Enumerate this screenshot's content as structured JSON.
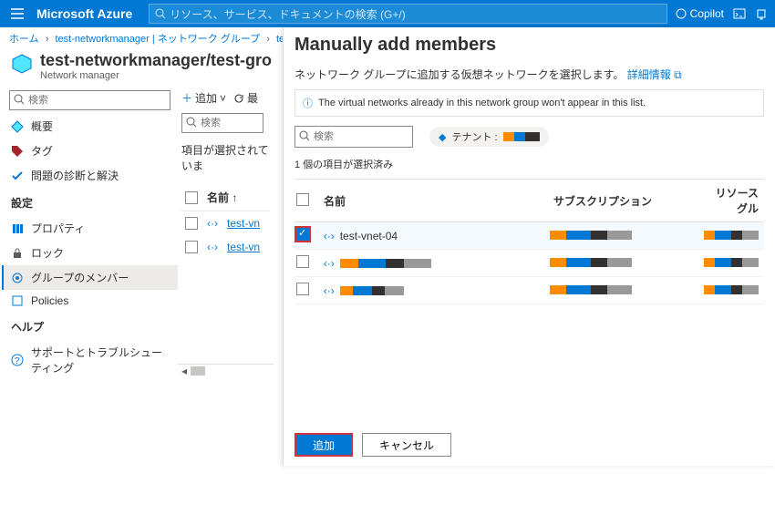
{
  "topbar": {
    "brand": "Microsoft Azure",
    "search_placeholder": "リソース、サービス、ドキュメントの検索 (G+/)",
    "copilot": "Copilot"
  },
  "breadcrumb": {
    "items": [
      "ホーム",
      "test-networkmanager | ネットワーク グループ",
      "test-n"
    ]
  },
  "page": {
    "title": "test-networkmanager/test-gro",
    "subtitle": "Network manager"
  },
  "side": {
    "search_placeholder": "検索",
    "items_top": [
      {
        "icon": "overview-icon",
        "label": "概要",
        "color": "#0078d4"
      },
      {
        "icon": "tag-icon",
        "label": "タグ",
        "color": "#a4262c"
      },
      {
        "icon": "diagnose-icon",
        "label": "問題の診断と解決",
        "color": "#0078d4"
      }
    ],
    "section1": "設定",
    "items_settings": [
      {
        "icon": "properties-icon",
        "label": "プロパティ",
        "color": "#0078d4"
      },
      {
        "icon": "lock-icon",
        "label": "ロック",
        "color": "#605e5c"
      },
      {
        "icon": "members-icon",
        "label": "グループのメンバー",
        "color": "#0078d4",
        "selected": true
      },
      {
        "icon": "policies-icon",
        "label": "Policies",
        "color": "#0078d4"
      }
    ],
    "section2": "ヘルプ",
    "items_help": [
      {
        "icon": "support-icon",
        "label": "サポートとトラブルシューティング",
        "color": "#0078d4"
      }
    ]
  },
  "main": {
    "toolbar": {
      "add": "追加",
      "refresh": "最"
    },
    "search_placeholder": "検索",
    "selection_msg": "項目が選択されていま",
    "col_name": "名前",
    "rows": [
      {
        "name": "test-vn"
      },
      {
        "name": "test-vn"
      }
    ]
  },
  "panel": {
    "title": "Manually add members",
    "desc": "ネットワーク グループに追加する仮想ネットワークを選択します。",
    "detail_link": "詳細情報",
    "info": "The virtual networks already in this network group won't appear in this list.",
    "search_placeholder": "検索",
    "tenant_label": "テナント :",
    "selected_count": "1 個の項目が選択済み",
    "columns": {
      "name": "名前",
      "subscription": "サブスクリプション",
      "rg": "リソース グル"
    },
    "rows": [
      {
        "name": "test-vnet-04",
        "checked": true
      },
      {
        "name": "",
        "checked": false
      },
      {
        "name": "",
        "checked": false
      }
    ],
    "add_btn": "追加",
    "cancel_btn": "キャンセル"
  }
}
